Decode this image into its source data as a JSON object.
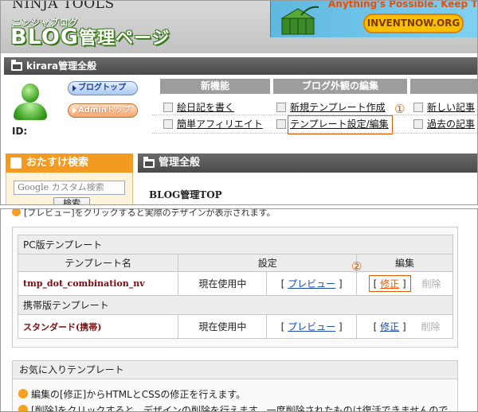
{
  "header": {
    "ninja_tools": "NINJA TOOLS",
    "subtitle": "ニンジャブログ",
    "title_blog": "BLOG",
    "title_admin": "管理ページ"
  },
  "ad": {
    "slogan": "Anything's Possible. Keep Thinki",
    "button": "INVENTNOW.ORG"
  },
  "account_bar": {
    "label": "kirara管理全般"
  },
  "user": {
    "id_label": "ID:"
  },
  "buttons": {
    "blog_top": "ブログトップ",
    "admin_top": "Adminトップ"
  },
  "menu": {
    "new_features": "新機能",
    "blog_appearance": "ブログ外観の編集",
    "new_features_items": [
      "絵日記を書く",
      "簡単アフィリエイト"
    ],
    "appearance_items": [
      "新規テンプレート作成",
      "テンプレート設定/編集"
    ],
    "third_items": [
      "新しい記事",
      "過去の記事"
    ],
    "annotation_1": "①"
  },
  "sidebar": {
    "search_title": "おたすけ検索",
    "search_placeholder": "カスタム検索",
    "google": "Google",
    "search_button": "検索"
  },
  "main": {
    "bar_label": "管理全般",
    "blog_top_heading": "BLOG管理TOP"
  },
  "bottom": {
    "cut_line": "[プレビュー]をクリックすると実際のデザインが表示されます。",
    "pc_section": "PC版テンプレート",
    "col_name": "テンプレート名",
    "col_setting": "設定",
    "col_edit": "編集",
    "annotation_2": "②",
    "pc_rows": [
      {
        "name": "tmp_dot_combination_nv",
        "status": "現在使用中",
        "preview": "プレビュー",
        "edit": "修正",
        "delete": "削除"
      }
    ],
    "mobile_section": "携帯版テンプレート",
    "mobile_rows": [
      {
        "name": "スタンダード(携帯)",
        "status": "現在使用中",
        "preview": "プレビュー",
        "edit": "修正",
        "delete": "削除"
      }
    ],
    "favorites_title": "お気に入りテンプレート",
    "notes": [
      "編集の[修正]からHTMLとCSSの修正を行えます。",
      "[削除]をクリックすると、デザインの削除を行えます。一度削除されたものは復活できませんので"
    ]
  },
  "colors": {
    "accent_orange": "#e35a00",
    "bar_gray": "#4a4a4a",
    "sidebar_orange": "#f39a22",
    "link_blue": "#1a4bb0"
  }
}
